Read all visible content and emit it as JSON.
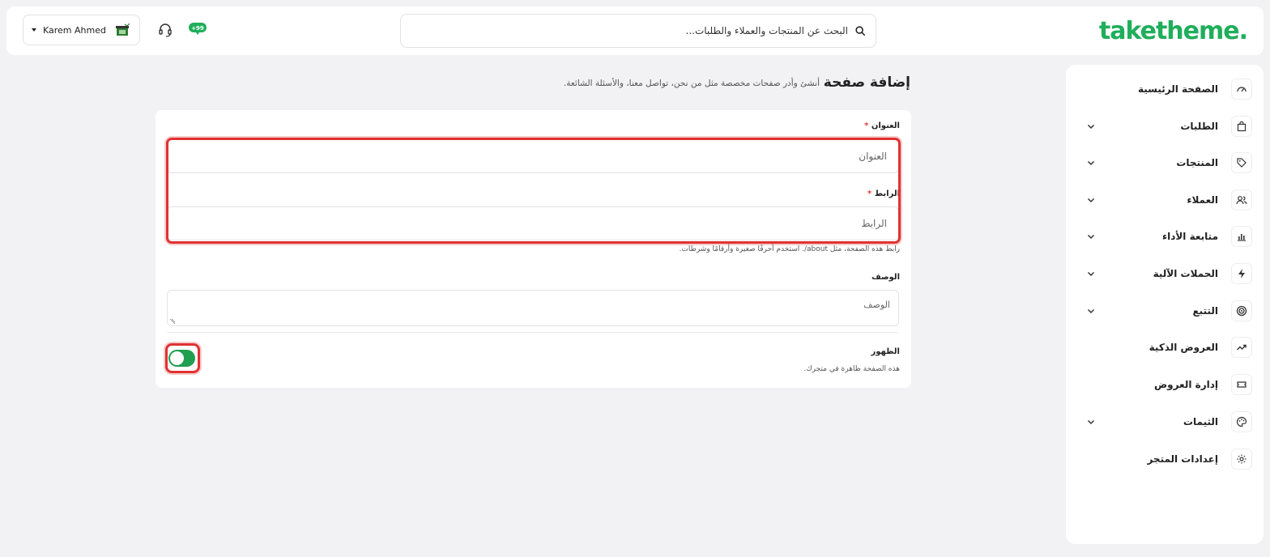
{
  "header": {
    "logo": "taketheme.",
    "search_placeholder": "البحث عن المنتجات والعملاء والطلبات...",
    "user_name": "Karem Ahmed"
  },
  "sidebar": {
    "items": [
      {
        "label": "الصفحة الرئيسية",
        "icon": "dashboard-gauge-icon",
        "has_chevron": false
      },
      {
        "label": "الطلبات",
        "icon": "shopping-bag-icon",
        "has_chevron": true
      },
      {
        "label": "المنتجات",
        "icon": "tag-icon",
        "has_chevron": true
      },
      {
        "label": "العملاء",
        "icon": "users-icon",
        "has_chevron": true
      },
      {
        "label": "متابعة الأداء",
        "icon": "bar-chart-icon",
        "has_chevron": true
      },
      {
        "label": "الحملات الآلية",
        "icon": "lightning-icon",
        "has_chevron": true
      },
      {
        "label": "التتبع",
        "icon": "target-icon",
        "has_chevron": true
      },
      {
        "label": "العروض الذكية",
        "icon": "trend-up-icon",
        "has_chevron": false
      },
      {
        "label": "إدارة العروض",
        "icon": "ticket-icon",
        "has_chevron": false
      },
      {
        "label": "الثيمات",
        "icon": "palette-icon",
        "has_chevron": true
      },
      {
        "label": "إعدادات المتجر",
        "icon": "gear-icon",
        "has_chevron": false
      }
    ]
  },
  "page": {
    "title": "إضافة صفحة",
    "subtitle": "أنشئ وأدر صفحات مخصصة مثل من نحن، تواصل معنا، والأسئلة الشائعة."
  },
  "form": {
    "title_label": "العنوان",
    "title_placeholder": "العنوان",
    "link_label": "الرابط",
    "link_placeholder": "الرابط",
    "link_help": "رابط هذه الصفحة، مثل about/. استخدم أحرفًا صغيرة وأرقامًا وشرطات.",
    "desc_label": "الوصف",
    "desc_placeholder": "الوصف",
    "visibility_label": "الظهور",
    "visibility_help": "هذه الصفحة ظاهرة في متجرك.",
    "visibility_on": true,
    "required_mark": "*"
  },
  "colors": {
    "brand_green": "#1fae5b",
    "toggle_on": "#1f9f4f",
    "highlight_red": "#e03232"
  }
}
